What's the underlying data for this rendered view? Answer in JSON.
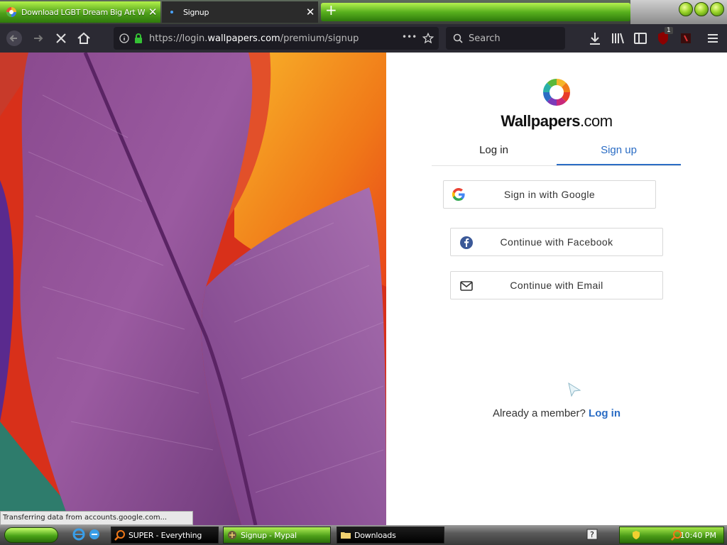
{
  "browser": {
    "tabs": [
      {
        "title": "Download LGBT Dream Big Art Wa",
        "close": "✕",
        "active": false
      },
      {
        "title": "Signup",
        "close": "✕",
        "active": true
      }
    ],
    "new_tab_glyph": "+",
    "url": {
      "prefix": "https://login.",
      "domain": "wallpapers.com",
      "path": "/premium/signup"
    },
    "url_more": "•••",
    "search_placeholder": "Search",
    "icons": [
      "back-icon",
      "forward-icon",
      "stop-icon",
      "home-icon",
      "info-icon",
      "lock-icon",
      "bookmark-star-icon",
      "search-icon",
      "download-icon",
      "library-icon",
      "sidebar-icon",
      "ublock-icon",
      "addon-icon",
      "menu-icon"
    ],
    "ublock_badge": "1",
    "status_text": "Transferring data from accounts.google.com..."
  },
  "page": {
    "brand": {
      "bold": "Wallpapers",
      "rest": ".com"
    },
    "tabs": {
      "login": "Log in",
      "signup": "Sign up",
      "active": "signup"
    },
    "buttons": {
      "google": "Sign in with Google",
      "facebook": "Continue with Facebook",
      "email": "Continue with Email"
    },
    "already_member": "Already a member?",
    "login_link": "Log in",
    "colors": {
      "accent": "#2a6cc4",
      "facebook": "#3b5998"
    }
  },
  "taskbar": {
    "items": [
      {
        "label": "SUPER - Everything",
        "icon": "magnifier-icon"
      },
      {
        "label": "Signup - Mypal",
        "icon": "browser-icon",
        "active": true
      },
      {
        "label": "Downloads",
        "icon": "folder-icon"
      }
    ],
    "clock": "10:40 PM"
  }
}
